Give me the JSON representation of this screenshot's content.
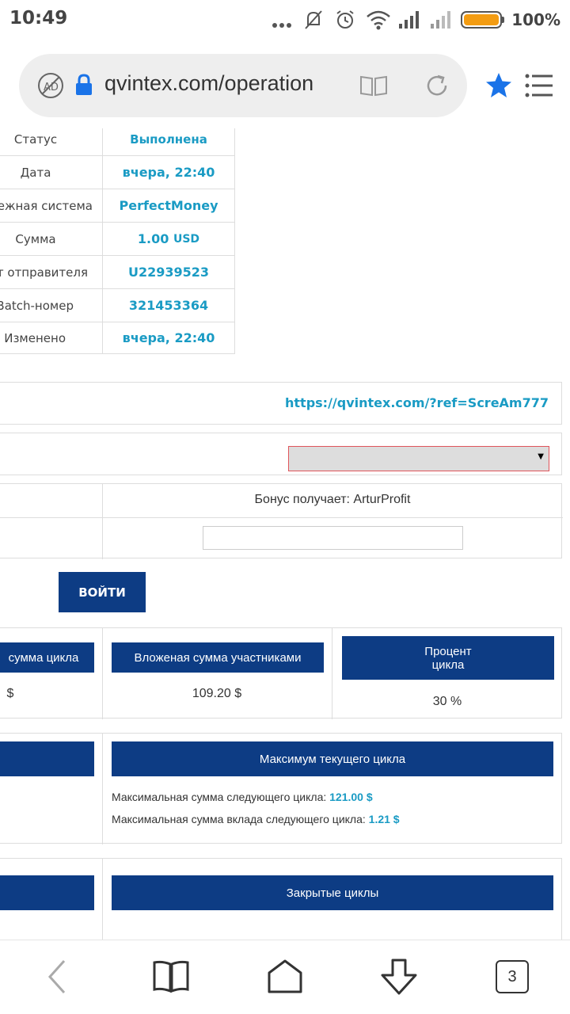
{
  "status_bar": {
    "time": "10:49",
    "battery": "100%",
    "battery_level": 1.0
  },
  "browser": {
    "url": "qvintex.com/operation",
    "tab_count": "3"
  },
  "operation_table": {
    "rows": [
      {
        "label": "Статус",
        "value": "Выполнена"
      },
      {
        "label": "Дата",
        "value": "вчера, 22:40"
      },
      {
        "label": "тежная система",
        "value": "PerfectMoney"
      },
      {
        "label": "Сумма",
        "value": "1.00",
        "unit": "USD"
      },
      {
        "label": "ет отправителя",
        "value": "U22939523"
      },
      {
        "label": "Batch-номер",
        "value": "321453364"
      },
      {
        "label": "Изменено",
        "value": "вчера, 22:40"
      }
    ]
  },
  "referral": {
    "link": "https://qvintex.com/?ref=ScreAm777"
  },
  "bonus": {
    "receiver": "Бонус получает: ArturProfit",
    "input_value": ""
  },
  "login": {
    "button": "ВОЙТИ"
  },
  "cycle_stats": {
    "col1_header": "сумма цикла",
    "col1_value": "$",
    "col2_header": "Вложеная сумма участниками",
    "col2_value": "109.20 $",
    "col3_header_line1": "Процент",
    "col3_header_line2": "цикла",
    "col3_value": "30 %"
  },
  "max_cycle": {
    "header": "Максимум текущего цикла",
    "line1_label": "Максимальная сумма следующего цикла:",
    "line1_value": "121.00 $",
    "line2_label": "Максимальная сумма вклада следующего цикла:",
    "line2_value": "1.21 $"
  },
  "closed_cycles": {
    "header": "Закрытые циклы"
  }
}
